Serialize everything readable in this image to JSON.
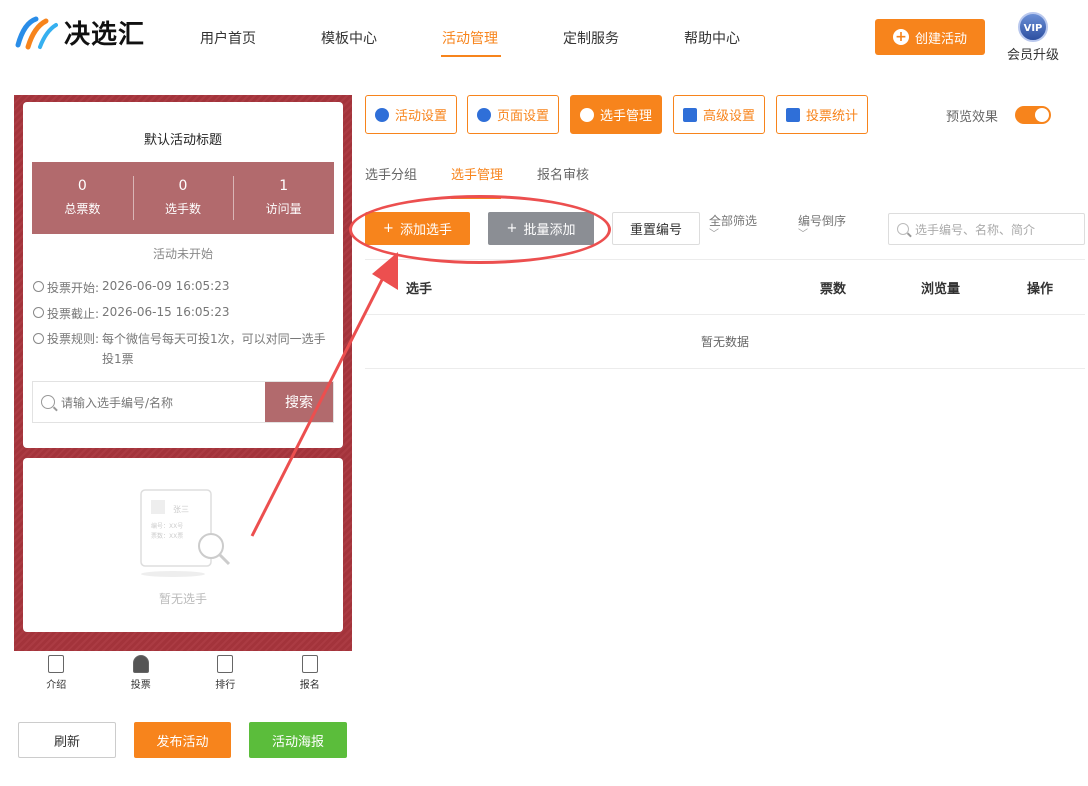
{
  "header": {
    "brand": "决选汇",
    "nav": [
      "用户首页",
      "模板中心",
      "活动管理",
      "定制服务",
      "帮助中心"
    ],
    "active_nav": "活动管理",
    "create_button": "创建活动",
    "vip_badge": "VIP",
    "vip_label": "会员升级",
    "accent_color": "#f7841c"
  },
  "preview": {
    "title": "默认活动标题",
    "stats": [
      {
        "value": "0",
        "label": "总票数"
      },
      {
        "value": "0",
        "label": "选手数"
      },
      {
        "value": "1",
        "label": "访问量"
      }
    ],
    "status": "活动未开始",
    "vote_start_label": "投票开始:",
    "vote_start": "2026-06-09 16:05:23",
    "vote_end_label": "投票截止:",
    "vote_end": "2026-06-15 16:05:23",
    "vote_rule_label": "投票规则:",
    "vote_rule": "每个微信号每天可投1次，可以对同一选手投1票",
    "search_placeholder": "请输入选手编号/名称",
    "search_button": "搜索",
    "empty_card": {
      "name": "张三",
      "number": "编号：XX号",
      "votes": "票数：XX票"
    },
    "empty_text": "暂无选手",
    "tabbar": [
      "介绍",
      "投票",
      "排行",
      "报名"
    ],
    "theme_color": "#a8353d"
  },
  "bottom_buttons": {
    "refresh": "刷新",
    "publish": "发布活动",
    "poster": "活动海报"
  },
  "toolbar": {
    "items": [
      "活动设置",
      "页面设置",
      "选手管理",
      "高级设置",
      "投票统计"
    ],
    "active": "选手管理",
    "preview_label": "预览效果"
  },
  "subtabs": [
    "选手分组",
    "选手管理",
    "报名审核"
  ],
  "actions": {
    "add": "添加选手",
    "batch_add": "批量添加",
    "renumber": "重置编号",
    "filter_all": "全部筛选",
    "sort": "编号倒序",
    "search_placeholder": "选手编号、名称、简介"
  },
  "table": {
    "columns": [
      "选手",
      "票数",
      "浏览量",
      "操作"
    ],
    "empty": "暂无数据"
  }
}
